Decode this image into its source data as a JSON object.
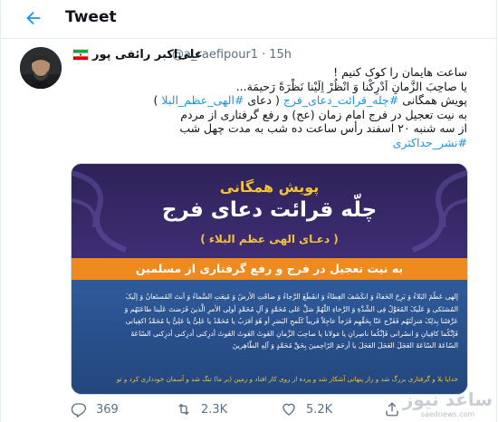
{
  "header": {
    "title": "Tweet"
  },
  "tweet": {
    "author_name": "علی‌اکبر رائفی پور",
    "handle": "@a_raefipour1",
    "separator": "·",
    "time": "15h",
    "lines": [
      "ساعت هایمان را کوک کنیم !",
      "یا صاحِبَ الزَّمانِ اَدْرِکْنا وَ انْظُرْ اِلَیْنا نَظْرَةً رَحیمَة...",
      "پویش همگانی #چله_قرائت_دعای_فرج ( دعای #الهی_عظم_البلا )",
      "به نیت تعجیل در فرج امام زمان (عج) و رفع گرفتاری از مردم",
      "از سه شنبه ۲۰ اسفند رأس ساعت ده شب به مدت چهل شب"
    ],
    "line3_prefix": "پویش همگانی ",
    "line3_tag1": "#چله_قرائت_دعای_فرج",
    "line3_mid": " ( دعای ",
    "line3_tag2": "#الهی_عظم_البلا",
    "line3_suffix": " )",
    "hashtag_last": "#نشر_حداکثری"
  },
  "media": {
    "line1": "پویش همگانی",
    "line2": "چلّه قرائت دعای فرج",
    "line3": "( دعـای الهی عظم البلاء )",
    "band": "به نیت تعجیل در فرج و رفع گرفتاری از مسلمین",
    "prayer": [
      "إلهی عَظُمَ البَلاءُ وَ بَرِحَ الخَفاءُ وَ انکَشَفَ الغِطاءُ وَ انقَطَعَ الرَّجاءُ وَ ضاقَتِ الأرضُ وَ مُنِعَتِ السَّماءُ وَ أنتَ المُستَعانُ وَ إلَیکَ",
      "المُشتَکی وَ عَلَیکَ المُعَوَّلُ فِی الشِّدَّةِ وَ الرَّخاءِ اللّهُمَّ صَلِّ عَلی مُحَمَّدٍ وَ آلِ مُحَمَّدٍ أولِی الأمرِ الَّذینَ فَرَضتَ عَلَینا طاعَتَهُم وَ",
      "عَرَّفتَنا بِذلِکَ مَنزِلَتَهُم فَفَرِّج عَنّا بِحَقِّهِم فَرَجاً عاجِلاً قَریباً کَلَمحِ البَصَرِ أو هُوَ أقرَبُ یا مُحَمَّدُ یا عَلِیُّ یا عَلِیُّ یا مُحَمَّدُ اکفِیانی",
      "فَإنَّکُما کافِیانِ وَ انصُرانی فَإنَّکُما ناصِرانِ یا مَولانا یا صاحِبَ الزَّمانِ الغَوثَ الغَوثَ الغَوثَ أدرِکنی أدرِکنی أدرِکنی السّاعَةَ",
      "السّاعَةَ السّاعَةَ العَجَلَ العَجَلَ العَجَلَ یا أرحَمَ الرّاحِمینَ بِحَقِّ مُحَمَّدٍ وَ آلِهِ الطّاهِرینَ"
    ],
    "footer": "خدایا بلا و گرفتاری بزرگ شد و راز پنهانی آشکار شد و پرده از روی کار افتاد و زمین (بر ما) تنگ شد و آسمان خودداری کرد و تو"
  },
  "actions": {
    "reply_count": "369",
    "retweet_count": "2.3K",
    "like_count": "5.2K"
  },
  "watermark": {
    "logo": "ساعد نیوز",
    "url": "saednews.com"
  },
  "colors": {
    "link": "#1b95e0",
    "text": "#0f1419",
    "muted": "#5b7083",
    "accent_orange": "#ef8a1f",
    "accent_gold": "#f3c23a"
  }
}
